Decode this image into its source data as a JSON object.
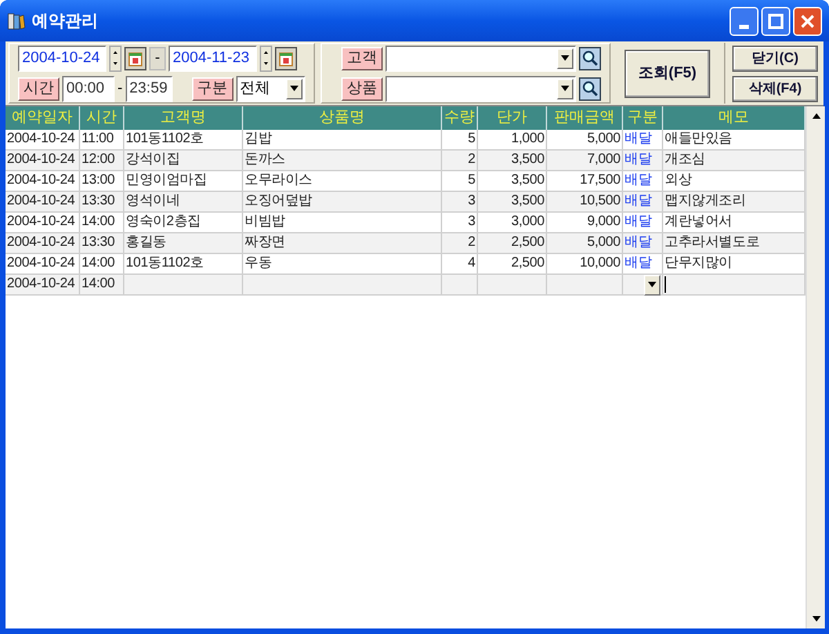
{
  "window": {
    "title": "예약관리"
  },
  "filters": {
    "date_from": "2004-10-24",
    "date_separator": "-",
    "date_to": "2004-11-23",
    "time_label": "시간",
    "time_from": "00:00",
    "time_separator": "-",
    "time_to": "23:59",
    "category_label": "구분",
    "category_value": "전체",
    "customer_label": "고객",
    "product_label": "상품"
  },
  "buttons": {
    "search": "조회(F5)",
    "close": "닫기(C)",
    "delete": "삭제(F4)"
  },
  "table": {
    "columns": [
      "예약일자",
      "시간",
      "고객명",
      "상품명",
      "수량",
      "단가",
      "판매금액",
      "구분",
      "메모"
    ],
    "rows": [
      {
        "date": "2004-10-24",
        "time": "11:00",
        "customer": "101동1102호",
        "product": "김밥",
        "qty": "5",
        "price": "1,000",
        "amount": "5,000",
        "type": "배달",
        "memo": "애들만있음",
        "editing": false
      },
      {
        "date": "2004-10-24",
        "time": "12:00",
        "customer": "강석이집",
        "product": "돈까스",
        "qty": "2",
        "price": "3,500",
        "amount": "7,000",
        "type": "배달",
        "memo": "개조심",
        "editing": false
      },
      {
        "date": "2004-10-24",
        "time": "13:00",
        "customer": "민영이엄마집",
        "product": "오무라이스",
        "qty": "5",
        "price": "3,500",
        "amount": "17,500",
        "type": "배달",
        "memo": "외상",
        "editing": false
      },
      {
        "date": "2004-10-24",
        "time": "13:30",
        "customer": "영석이네",
        "product": "오징어덮밥",
        "qty": "3",
        "price": "3,500",
        "amount": "10,500",
        "type": "배달",
        "memo": "맵지않게조리",
        "editing": false
      },
      {
        "date": "2004-10-24",
        "time": "14:00",
        "customer": "영숙이2층집",
        "product": "비빔밥",
        "qty": "3",
        "price": "3,000",
        "amount": "9,000",
        "type": "배달",
        "memo": "계란넣어서",
        "editing": false
      },
      {
        "date": "2004-10-24",
        "time": "13:30",
        "customer": "홍길동",
        "product": "짜장면",
        "qty": "2",
        "price": "2,500",
        "amount": "5,000",
        "type": "배달",
        "memo": "고추라서별도로",
        "editing": false
      },
      {
        "date": "2004-10-24",
        "time": "14:00",
        "customer": "101동1102호",
        "product": "우동",
        "qty": "4",
        "price": "2,500",
        "amount": "10,000",
        "type": "배달",
        "memo": "단무지많이",
        "editing": false
      },
      {
        "date": "2004-10-24",
        "time": "14:00",
        "editing": true
      }
    ]
  }
}
